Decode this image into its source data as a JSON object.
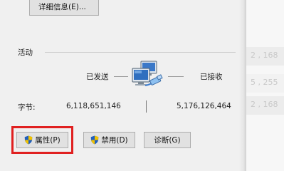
{
  "details_button_label": "详细信息(E)...",
  "activity_label": "活动",
  "sent_label": "已发送",
  "received_label": "已接收",
  "bytes_label": "字节:",
  "bytes_sent": "6,118,651,146",
  "bytes_received": "5,176,126,464",
  "buttons": {
    "properties": "属性(P)",
    "disable": "禁用(D)",
    "diagnose": "诊断(G)"
  },
  "background_values": [
    "2 , 168",
    "5 , 255",
    "2 , 168"
  ],
  "icons": [
    "network-computers-icon",
    "shield-icon"
  ],
  "colors": {
    "highlight": "#e02020",
    "shield_blue": "#1f5fbf",
    "shield_yellow": "#f2c200"
  }
}
